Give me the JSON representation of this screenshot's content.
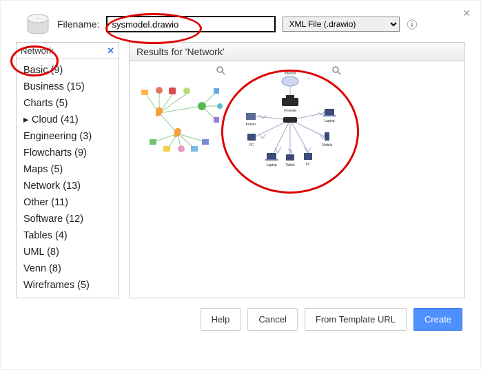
{
  "header": {
    "filename_label": "Filename:",
    "filename_value": "sysmodel.drawio",
    "filetype_selected": "XML File (.drawio)"
  },
  "sidebar": {
    "search_value": "Network",
    "categories": [
      {
        "label": "Basic (9)",
        "expandable": false
      },
      {
        "label": "Business (15)",
        "expandable": false
      },
      {
        "label": "Charts (5)",
        "expandable": false
      },
      {
        "label": "Cloud (41)",
        "expandable": true
      },
      {
        "label": "Engineering (3)",
        "expandable": false
      },
      {
        "label": "Flowcharts (9)",
        "expandable": false
      },
      {
        "label": "Maps (5)",
        "expandable": false
      },
      {
        "label": "Network (13)",
        "expandable": false
      },
      {
        "label": "Other (11)",
        "expandable": false
      },
      {
        "label": "Software (12)",
        "expandable": false
      },
      {
        "label": "Tables (4)",
        "expandable": false
      },
      {
        "label": "UML (8)",
        "expandable": false
      },
      {
        "label": "Venn (8)",
        "expandable": false
      },
      {
        "label": "Wireframes (5)",
        "expandable": false
      }
    ]
  },
  "results": {
    "header": "Results for 'Network'"
  },
  "buttons": {
    "help": "Help",
    "cancel": "Cancel",
    "from_template": "From Template URL",
    "create": "Create"
  },
  "thumb2_labels": {
    "internet": "Internet",
    "firewall": "Firewall",
    "printer": "Printer",
    "laptop": "Laptop",
    "pc1": "PC",
    "mobile": "Mobile",
    "laptop2": "Laptop",
    "tablet": "Tablet",
    "pc2": "PC"
  }
}
